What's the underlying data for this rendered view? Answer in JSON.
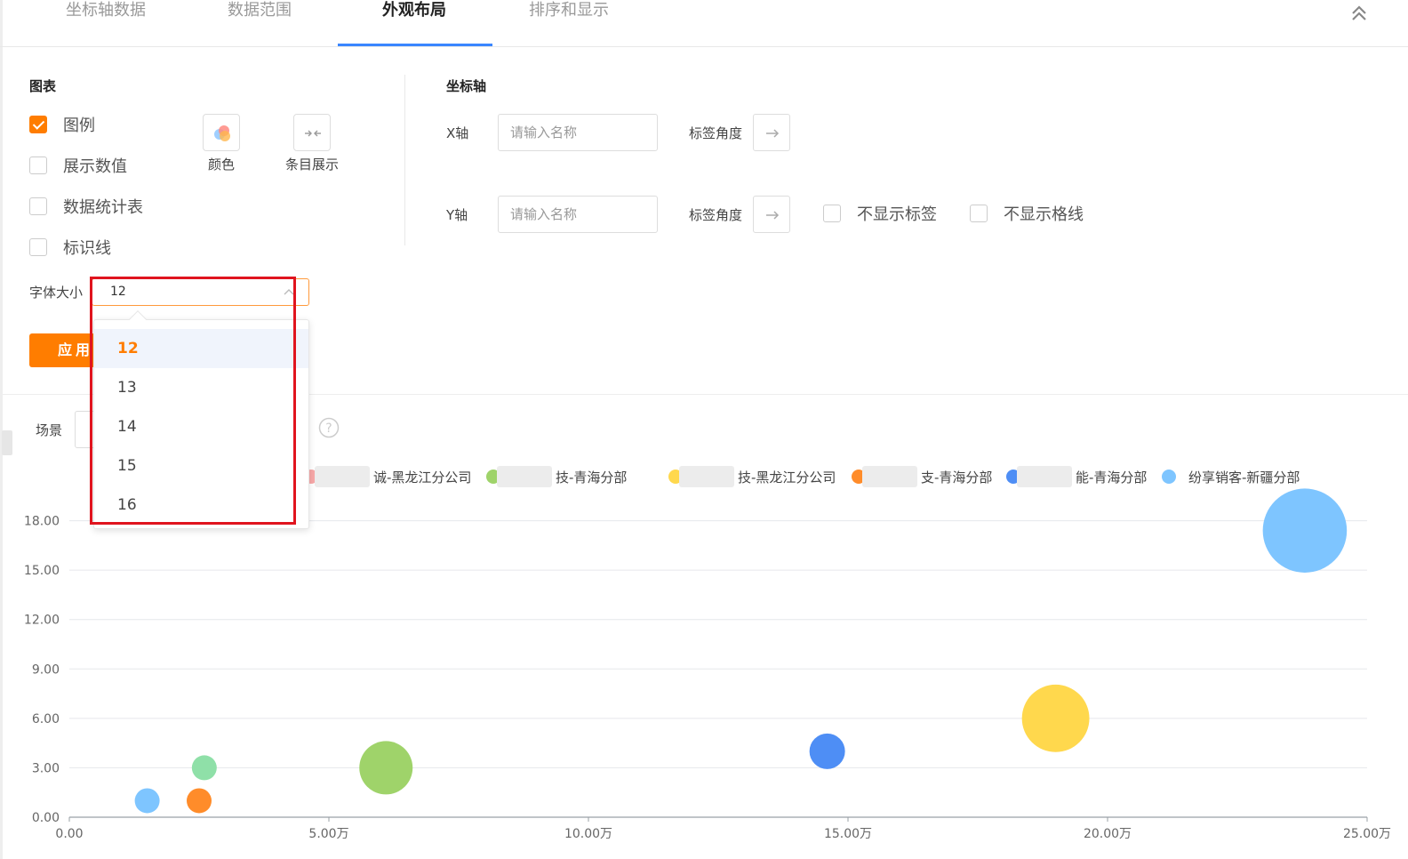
{
  "tabs": [
    {
      "label": "坐标轴数据",
      "active": false
    },
    {
      "label": "数据范围",
      "active": false
    },
    {
      "label": "外观布局",
      "active": true
    },
    {
      "label": "排序和显示",
      "active": false
    }
  ],
  "chart_section": {
    "title": "图表",
    "options": [
      {
        "label": "图例",
        "checked": true
      },
      {
        "label": "展示数值",
        "checked": false
      },
      {
        "label": "数据统计表",
        "checked": false
      },
      {
        "label": "标识线",
        "checked": false
      }
    ],
    "color_label": "颜色",
    "entry_label": "条目展示",
    "font_size_label": "字体大小",
    "font_size_value": "12",
    "font_size_options": [
      "12",
      "13",
      "14",
      "15",
      "16"
    ],
    "apply_label": "应用"
  },
  "axis_section": {
    "title": "坐标轴",
    "x_label": "X轴",
    "y_label": "Y轴",
    "name_placeholder": "请输入名称",
    "angle_label": "标签角度",
    "hide_labels": "不显示标签",
    "hide_grid": "不显示格线"
  },
  "scene_label": "场景",
  "chart_data": {
    "type": "scatter",
    "legend": [
      {
        "name": "诚-黑龙江分公司",
        "color": "#f7a8a8"
      },
      {
        "name": "技-青海分部",
        "color": "#9fd36a"
      },
      {
        "name": "技-黑龙江分公司",
        "color": "#ffd84d"
      },
      {
        "name": "支-青海分部",
        "color": "#ff8c2a"
      },
      {
        "name": "能-青海分部",
        "color": "#4e8ef5"
      },
      {
        "name": "纷享销客-新疆分部",
        "color": "#7ec5ff"
      }
    ],
    "y_ticks": [
      "0.00",
      "3.00",
      "6.00",
      "9.00",
      "12.00",
      "15.00",
      "18.00"
    ],
    "x_ticks": [
      "0.00",
      "5.00万",
      "10.00万",
      "15.00万",
      "20.00万",
      "25.00万"
    ],
    "xlim": [
      0,
      250000
    ],
    "ylim": [
      0,
      21
    ],
    "points": [
      {
        "x": 15000,
        "y": 1,
        "size": 1,
        "color": "#7ec5ff"
      },
      {
        "x": 25000,
        "y": 1,
        "size": 1,
        "color": "#ff8c2a"
      },
      {
        "x": 26000,
        "y": 3,
        "size": 1,
        "color": "#8fe0a8"
      },
      {
        "x": 61000,
        "y": 3,
        "size": 3,
        "color": "#9fd36a"
      },
      {
        "x": 146000,
        "y": 4,
        "size": 2,
        "color": "#4e8ef5"
      },
      {
        "x": 190000,
        "y": 6,
        "size": 3.6,
        "color": "#ffd84d"
      },
      {
        "x": 238000,
        "y": 17.4,
        "size": 4.2,
        "color": "#7ec5ff"
      }
    ]
  }
}
